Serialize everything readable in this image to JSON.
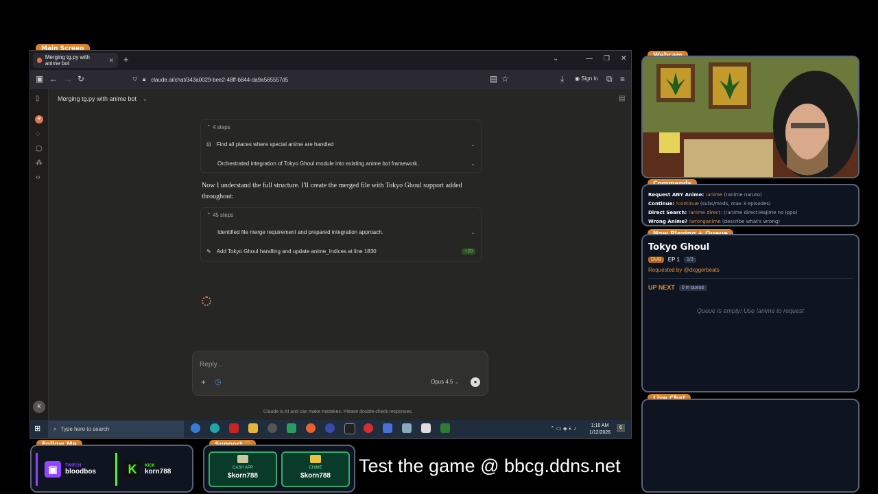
{
  "overlay": {
    "main_screen_label": "Main Screen",
    "webcam_label": "Webcam",
    "commands_label": "Commands",
    "now_playing_label": "Now Playing + Queue",
    "live_chat_label": "Live Chat",
    "follow_me_label": "Follow Me",
    "support_label": "Support ♡"
  },
  "browser": {
    "tab_title": "Merging tg.py with anime bot",
    "url": "claude.ai/chat/343a0029-bee2-48ff-b844-da9a565557d5",
    "sign_in": "Sign in"
  },
  "chat": {
    "title": "Merging tg.py with anime bot",
    "group1": {
      "header": "4 steps",
      "steps": [
        "Find all places where special anime are handled",
        "Orchestrated integration of Tokyo Ghoul module into existing anime bot framework."
      ]
    },
    "body_text": "Now I understand the full structure. I'll create the merged file with Tokyo Ghoul support added throughout:",
    "group2": {
      "header": "45 steps",
      "steps": [
        "Identified file merge requirement and prepared integration approach.",
        "Add Tokyo Ghoul handling and update anime_Indices at line 1830"
      ],
      "badge": "+20"
    },
    "reply_placeholder": "Reply...",
    "model": "Opus 4.5",
    "disclaimer": "Claude is AI and can make mistakes. Please double-check responses.",
    "avatar": "K"
  },
  "taskbar": {
    "search_placeholder": "Type here to search",
    "time": "1:10 AM",
    "date": "1/12/2026"
  },
  "commands": [
    {
      "label": "Request ANY Anime:",
      "cmd": "!anime",
      "hint": "(!anime naruto)"
    },
    {
      "label": "Continue:",
      "cmd": "!continue",
      "hint": "(subs/mods, max 3 episodes)"
    },
    {
      "label": "Direct Search:",
      "cmd": "!anime direct:",
      "hint": "(!anime direct:Hajime no Ippo)"
    },
    {
      "label": "Wrong Anime?",
      "cmd": "!wronganime",
      "hint": "(describe what's wrong)"
    }
  ],
  "now_playing": {
    "title": "Tokyo Ghoul",
    "dub": "DUB",
    "episode": "EP 1",
    "progress": "1/3",
    "requested_by": "Requested by @dxggerbeats",
    "up_next": "UP NEXT",
    "queue_count": "0 in queue",
    "queue_empty": "Queue is empty! Use !anime to request"
  },
  "socials": [
    {
      "platform": "TWITCH",
      "handle": "bloodbos"
    },
    {
      "platform": "KICK",
      "handle": "korn788"
    }
  ],
  "support": [
    {
      "method": "CASH APP",
      "handle": "$korn788"
    },
    {
      "method": "CHIME",
      "handle": "$korn788"
    }
  ],
  "promo_text": "Test the game @ bbcg.ddns.net",
  "colors": {
    "accent": "#d9822b",
    "claude": "#d97757",
    "panel_border": "#5a6478"
  }
}
